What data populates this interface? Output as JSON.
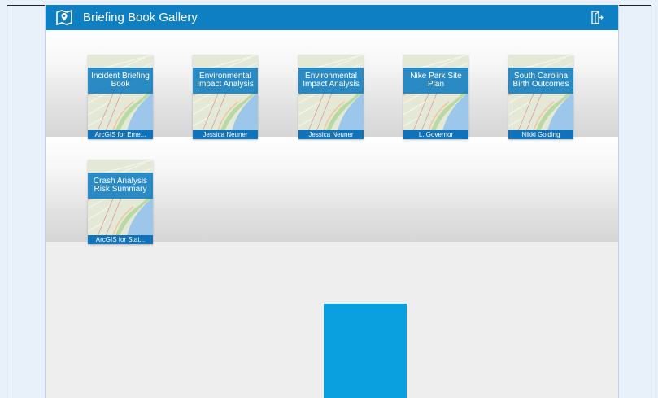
{
  "header": {
    "title": "Briefing Book Gallery",
    "logo_icon": "map-marker-book-icon",
    "signout_icon": "sign-out-icon",
    "bg_color": "#0f7fc4"
  },
  "books": [
    {
      "title": "Incident Briefing Book",
      "author": "ArcGIS for Eme..."
    },
    {
      "title": "Environmental Impact Analysis",
      "author": "Jessica Neuner"
    },
    {
      "title": "Environmental Impact Analysis",
      "author": "Jessica Neuner"
    },
    {
      "title": "Nike Park Site Plan",
      "author": "L. Governor"
    },
    {
      "title": "South Carolina Birth Outcomes",
      "author": "Nikki Golding"
    },
    {
      "title": "Crash Analysis Risk Summary",
      "author": "ArcGIS for Stat..."
    }
  ],
  "colors": {
    "accent": "#0f7fc4",
    "loading_block": "#0aa0e0",
    "page_bg": "#e8f0fa"
  }
}
